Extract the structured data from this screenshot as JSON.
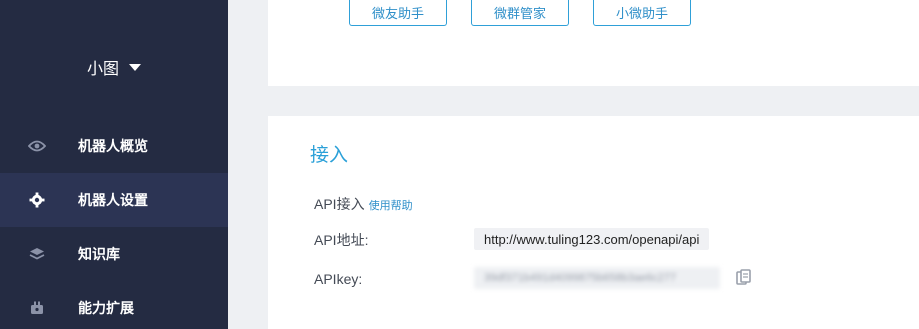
{
  "sidebar": {
    "bot_name": "小图",
    "items": [
      {
        "label": "机器人概览",
        "icon": "eye-icon"
      },
      {
        "label": "机器人设置",
        "icon": "gear-icon"
      },
      {
        "label": "知识库",
        "icon": "layers-icon"
      },
      {
        "label": "能力扩展",
        "icon": "plug-icon"
      }
    ],
    "active_index": 1
  },
  "assistants": [
    "微友助手",
    "微群管家",
    "小微助手"
  ],
  "access": {
    "title": "接入",
    "api_access_label": "API接入",
    "help_link": "使用帮助",
    "api_url_label": "API地址:",
    "api_url": "http://www.tuling123.com/openapi/api",
    "apikey_label": "APIkey:",
    "apikey_masked": "39df371b491d4099875b658b3ae6c277"
  },
  "colors": {
    "sidebar_bg": "#242b42",
    "sidebar_active": "#2c3454",
    "accent": "#2aa0d8"
  }
}
